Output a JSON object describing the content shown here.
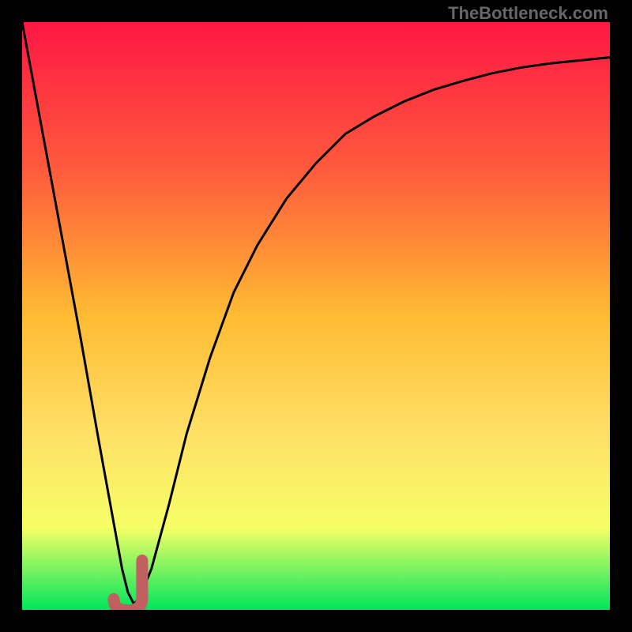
{
  "watermark": "TheBottleneck.com",
  "colors": {
    "frame": "#000000",
    "gradient": [
      "#ff1744",
      "#ff5a3c",
      "#ffbb33",
      "#ffe066",
      "#f6ff66",
      "#00e65b"
    ],
    "curve": "#000000",
    "marker": "#c06060"
  },
  "chart_data": {
    "type": "line",
    "title": "",
    "xlabel": "",
    "ylabel": "",
    "xlim": [
      0,
      100
    ],
    "ylim": [
      0,
      100
    ],
    "x": [
      0,
      5,
      10,
      13,
      15,
      17,
      18,
      19,
      20,
      22,
      25,
      28,
      32,
      36,
      40,
      45,
      50,
      55,
      60,
      65,
      70,
      75,
      80,
      85,
      90,
      95,
      100
    ],
    "values": [
      100,
      73,
      46,
      29,
      18,
      7,
      3,
      1,
      2,
      7,
      18,
      30,
      43,
      54,
      62,
      70,
      76,
      81,
      84,
      86.5,
      88.5,
      90,
      91.3,
      92.3,
      93,
      93.5,
      94
    ],
    "marker": {
      "x": 18,
      "y": 1,
      "shape": "J"
    },
    "note": "Values estimated from pixel positions; y represents visual height (0 at bottom, 100 at top)."
  }
}
